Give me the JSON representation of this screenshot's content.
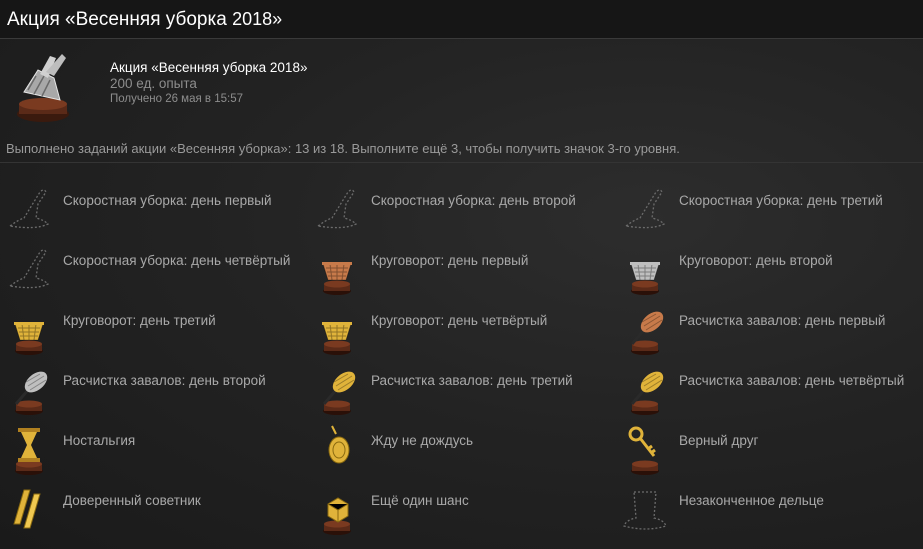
{
  "header": {
    "title_main": "Акция «Весенняя уборка ",
    "title_year": "2018»"
  },
  "summary": {
    "icon": "broom-dustpan-trophy-icon",
    "name": "Акция «Весенняя уборка 2018»",
    "xp": "200 ед. опыта",
    "unlocked": "Получено 26 мая в 15:57"
  },
  "progress_text": "Выполнено заданий акции «Весенняя уборка»: 13 из 18. Выполните ещё 3, чтобы получить значок 3-го уровня.",
  "badges": [
    {
      "label": "Скоростная уборка: день первый",
      "icon": "witch-hat-outline-icon",
      "earned": false
    },
    {
      "label": "Скоростная уборка: день второй",
      "icon": "witch-hat-outline-icon",
      "earned": false
    },
    {
      "label": "Скоростная уборка: день третий",
      "icon": "witch-hat-outline-icon",
      "earned": false
    },
    {
      "label": "Скоростная уборка: день четвёртый",
      "icon": "witch-hat-outline-icon",
      "earned": false
    },
    {
      "label": "Круговорот: день первый",
      "icon": "basket-bronze-icon",
      "earned": true
    },
    {
      "label": "Круговорот: день второй",
      "icon": "basket-silver-icon",
      "earned": true
    },
    {
      "label": "Круговорот: день третий",
      "icon": "basket-gold-icon",
      "earned": true
    },
    {
      "label": "Круговорот: день четвёртый",
      "icon": "basket-gold-icon",
      "earned": true
    },
    {
      "label": "Расчистка завалов: день первый",
      "icon": "feather-duster-bronze-icon",
      "earned": true
    },
    {
      "label": "Расчистка завалов: день второй",
      "icon": "feather-duster-silver-icon",
      "earned": true
    },
    {
      "label": "Расчистка завалов: день третий",
      "icon": "feather-duster-gold-icon",
      "earned": true
    },
    {
      "label": "Расчистка завалов: день четвёртый",
      "icon": "feather-duster-gold-icon",
      "earned": true
    },
    {
      "label": "Ностальгия",
      "icon": "hourglass-gold-icon",
      "earned": true
    },
    {
      "label": "Жду не дождусь",
      "icon": "pocket-watch-gold-icon",
      "earned": true
    },
    {
      "label": "Верный друг",
      "icon": "key-gold-icon",
      "earned": true
    },
    {
      "label": "Доверенный советник",
      "icon": "gold-bars-icon",
      "earned": true
    },
    {
      "label": "Ещё один шанс",
      "icon": "dice-gold-icon",
      "earned": true
    },
    {
      "label": "Незаконченное дельце",
      "icon": "top-hat-outline-icon",
      "earned": false
    }
  ],
  "colors": {
    "bronze": "#c77a4a",
    "silver": "#bfbfbf",
    "gold": "#e0b33a",
    "pedestal": "#5a2a18",
    "outline": "#6c6c6c"
  }
}
